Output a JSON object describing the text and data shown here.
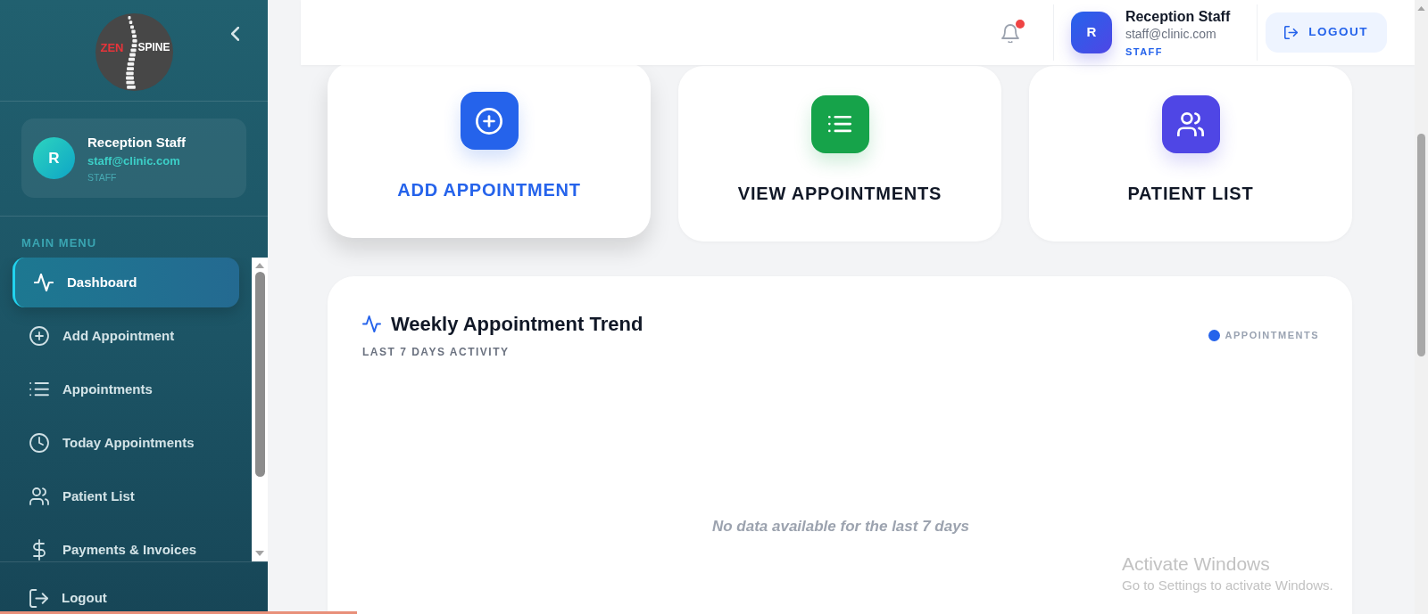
{
  "sidebar": {
    "logo": {
      "words": [
        "ZEN",
        "SPINE"
      ]
    },
    "user": {
      "initial": "R",
      "name": "Reception Staff",
      "email": "staff@clinic.com",
      "role": "STAFF"
    },
    "menu": {
      "title": "MAIN MENU",
      "items": [
        {
          "label": "Dashboard",
          "selected": true
        },
        {
          "label": "Add Appointment",
          "selected": false
        },
        {
          "label": "Appointments",
          "selected": false
        },
        {
          "label": "Today Appointments",
          "selected": false
        },
        {
          "label": "Patient List",
          "selected": false
        },
        {
          "label": "Payments & Invoices",
          "selected": false
        }
      ]
    },
    "footer": {
      "label": "Logout"
    }
  },
  "header": {
    "notifications": {
      "unread": true
    },
    "user": {
      "initial": "R",
      "name": "Reception Staff",
      "email": "staff@clinic.com",
      "role": "STAFF"
    },
    "logout": {
      "label": "LOGOUT"
    }
  },
  "quick_actions": [
    {
      "label": "ADD APPOINTMENT",
      "color": "#2563eb",
      "hovered": true
    },
    {
      "label": "VIEW APPOINTMENTS",
      "color": "#16a34a",
      "hovered": false
    },
    {
      "label": "PATIENT LIST",
      "color": "#4f46e5",
      "hovered": false
    }
  ],
  "chart_panel": {
    "title": "Weekly Appointment Trend",
    "subtitle": "LAST 7 DAYS ACTIVITY",
    "legend": [
      {
        "label": "APPOINTMENTS",
        "color": "#2563eb"
      }
    ],
    "empty_message": "No data available for the last 7 days"
  },
  "os_notice": {
    "title": "Activate Windows",
    "message": "Go to Settings to activate Windows."
  }
}
